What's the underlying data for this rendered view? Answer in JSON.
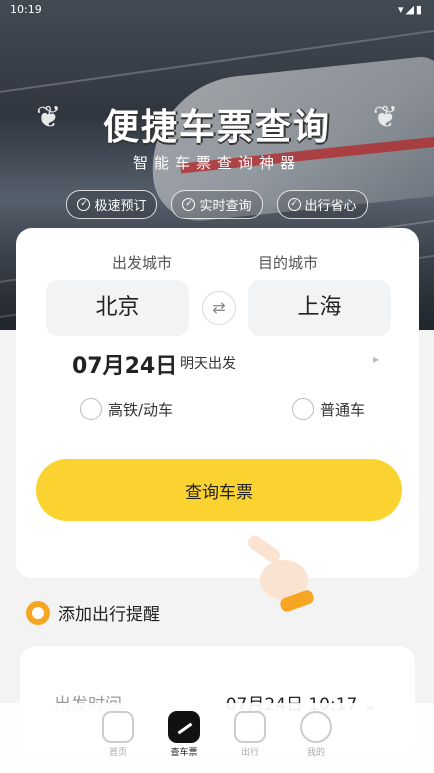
{
  "status": {
    "time": "10:19",
    "signal": "▾◢▮"
  },
  "hero": {
    "title": "便捷车票查询",
    "subtitle": "智能车票查询神器",
    "tags": [
      "极速预订",
      "实时查询",
      "出行省心"
    ]
  },
  "search": {
    "from_label": "出发城市",
    "to_label": "目的城市",
    "from_city": "北京",
    "to_city": "上海",
    "swap_icon": "⇄",
    "date": "07月24日",
    "date_hint": "明天出发",
    "date_arrow": "▸",
    "option_highspeed": "高铁/动车",
    "option_normal": "普通车",
    "query_button": "查询车票"
  },
  "reminder": {
    "label": "添加出行提醒"
  },
  "reminder_card": {
    "row_label": "出发时间",
    "row_value": "07月24日 10:17 ⌄"
  },
  "nav": [
    {
      "label": "首页"
    },
    {
      "label": "查车票"
    },
    {
      "label": "出行"
    },
    {
      "label": "我的"
    }
  ],
  "colors": {
    "accent": "#fbd331",
    "card": "#ffffff",
    "background": "#f3f3f3"
  }
}
